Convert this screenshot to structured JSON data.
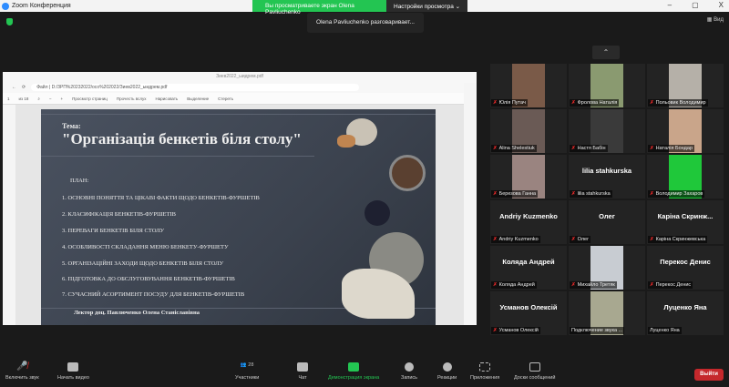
{
  "window": {
    "title": "Zoom Конференция",
    "minimize": "–",
    "maximize": "▢",
    "close": "X"
  },
  "banner": {
    "viewing": "Вы просматриваете экран Olena Pavliuchenko",
    "view_settings": "Настройки просмотра ⌄"
  },
  "talking": "Olena Pavliuchenko разговаривает...",
  "view_button": "Вид",
  "browser": {
    "tab_title": "Зиев2022_ыидрем.pdf",
    "url_label": "Файл",
    "url": "D:/ЗРП%20232022/осо%202022/Зиев2022_ыидрем.pdf",
    "page": "1",
    "page_of": "из 18",
    "tools": [
      "Просмотр страниц",
      "Прочесть вслух",
      "Нарисовать",
      "Выделение",
      "Стереть"
    ]
  },
  "slide": {
    "tema": "Тема:",
    "title": "\"Організація бенкетів біля столу\"",
    "plan": "ПЛАН:",
    "items": [
      "1. ОСНОВНІ ПОНЯТТЯ ТА ЦІКАВІ ФАКТИ ЩОДО БЕНКЕТІВ-ФУРШЕТІВ",
      "2. КЛАСИФІКАЦІЯ БЕНКЕТІВ-ФУРШЕТІВ",
      "3. ПЕРЕВАГИ БЕНКЕТІВ БІЛЯ СТОЛУ",
      "4. ОСОБЛИВОСТІ СКЛАДАННЯ МЕНЮ БЕНКЕТУ-ФУРШЕТУ",
      "5. ОРГАНІЗАЦІЙНІ ЗАХОДИ ЩОДО БЕНКЕТІВ БІЛЯ СТОЛУ",
      "6. ПІДГОТОВКА ДО ОБСЛУГОВУВАННЯ БЕНКЕТІВ-ФУРШЕТІВ",
      "7. СУЧАСНИЙ АСОРТИМЕНТ ПОСУДУ ДЛЯ БЕНКЕТІВ-ФУРШЕТІВ"
    ],
    "lector": "Лектор доц. Павлюченко Олена Станіславівна"
  },
  "participants": [
    {
      "name": "Юлія Путач",
      "big": "",
      "color": "#7a5a48"
    },
    {
      "name": "Фролова Наталія",
      "big": "",
      "color": "#8a9a70"
    },
    {
      "name": "Польовик Володимир",
      "big": "",
      "color": "#b5b0a8"
    },
    {
      "name": "Alina Shelestiuk",
      "big": "",
      "color": "#6a5a55"
    },
    {
      "name": "Настя Бабін",
      "big": "",
      "color": "#3a3a3a"
    },
    {
      "name": "Наталія Бондар",
      "big": "",
      "color": "#c9a58a"
    },
    {
      "name": "Березова Ганна",
      "big": "",
      "color": "#9a8480"
    },
    {
      "name": "lilia stahkurska",
      "big": "lilia stahkurska",
      "color": ""
    },
    {
      "name": "Володимир Захаров",
      "big": "",
      "color": "#1fc83a"
    },
    {
      "name": "Andriy Kuzmenko",
      "big": "Andriy Kuzmenko",
      "color": ""
    },
    {
      "name": "Олег",
      "big": "Олег",
      "color": ""
    },
    {
      "name": "Каріна Скринжевська",
      "big": "Каріна Скринж...",
      "color": ""
    },
    {
      "name": "Коляда Андрей",
      "big": "Коляда Андрей",
      "color": ""
    },
    {
      "name": "Михайло Третяк",
      "big": "",
      "color": "#c8ccd2"
    },
    {
      "name": "Перекос Денис",
      "big": "Перекос Денис",
      "color": ""
    },
    {
      "name": "Усманов Олексій",
      "big": "Усманов Олексій",
      "color": ""
    },
    {
      "name": "Подключение звука ...",
      "big": "",
      "color": "#a8a890"
    },
    {
      "name": "Луценко Яна",
      "big": "Луценко Яна",
      "color": ""
    }
  ],
  "toolbar": {
    "unmute": "Включить звук",
    "start_video": "Начать видео",
    "participants": "Участники",
    "participants_count": "28",
    "chat": "Чат",
    "share": "Демонстрация экрана",
    "record": "Запись",
    "reactions": "Реакции",
    "apps": "Приложения",
    "whiteboards": "Доски сообщений",
    "leave": "Выйти"
  }
}
